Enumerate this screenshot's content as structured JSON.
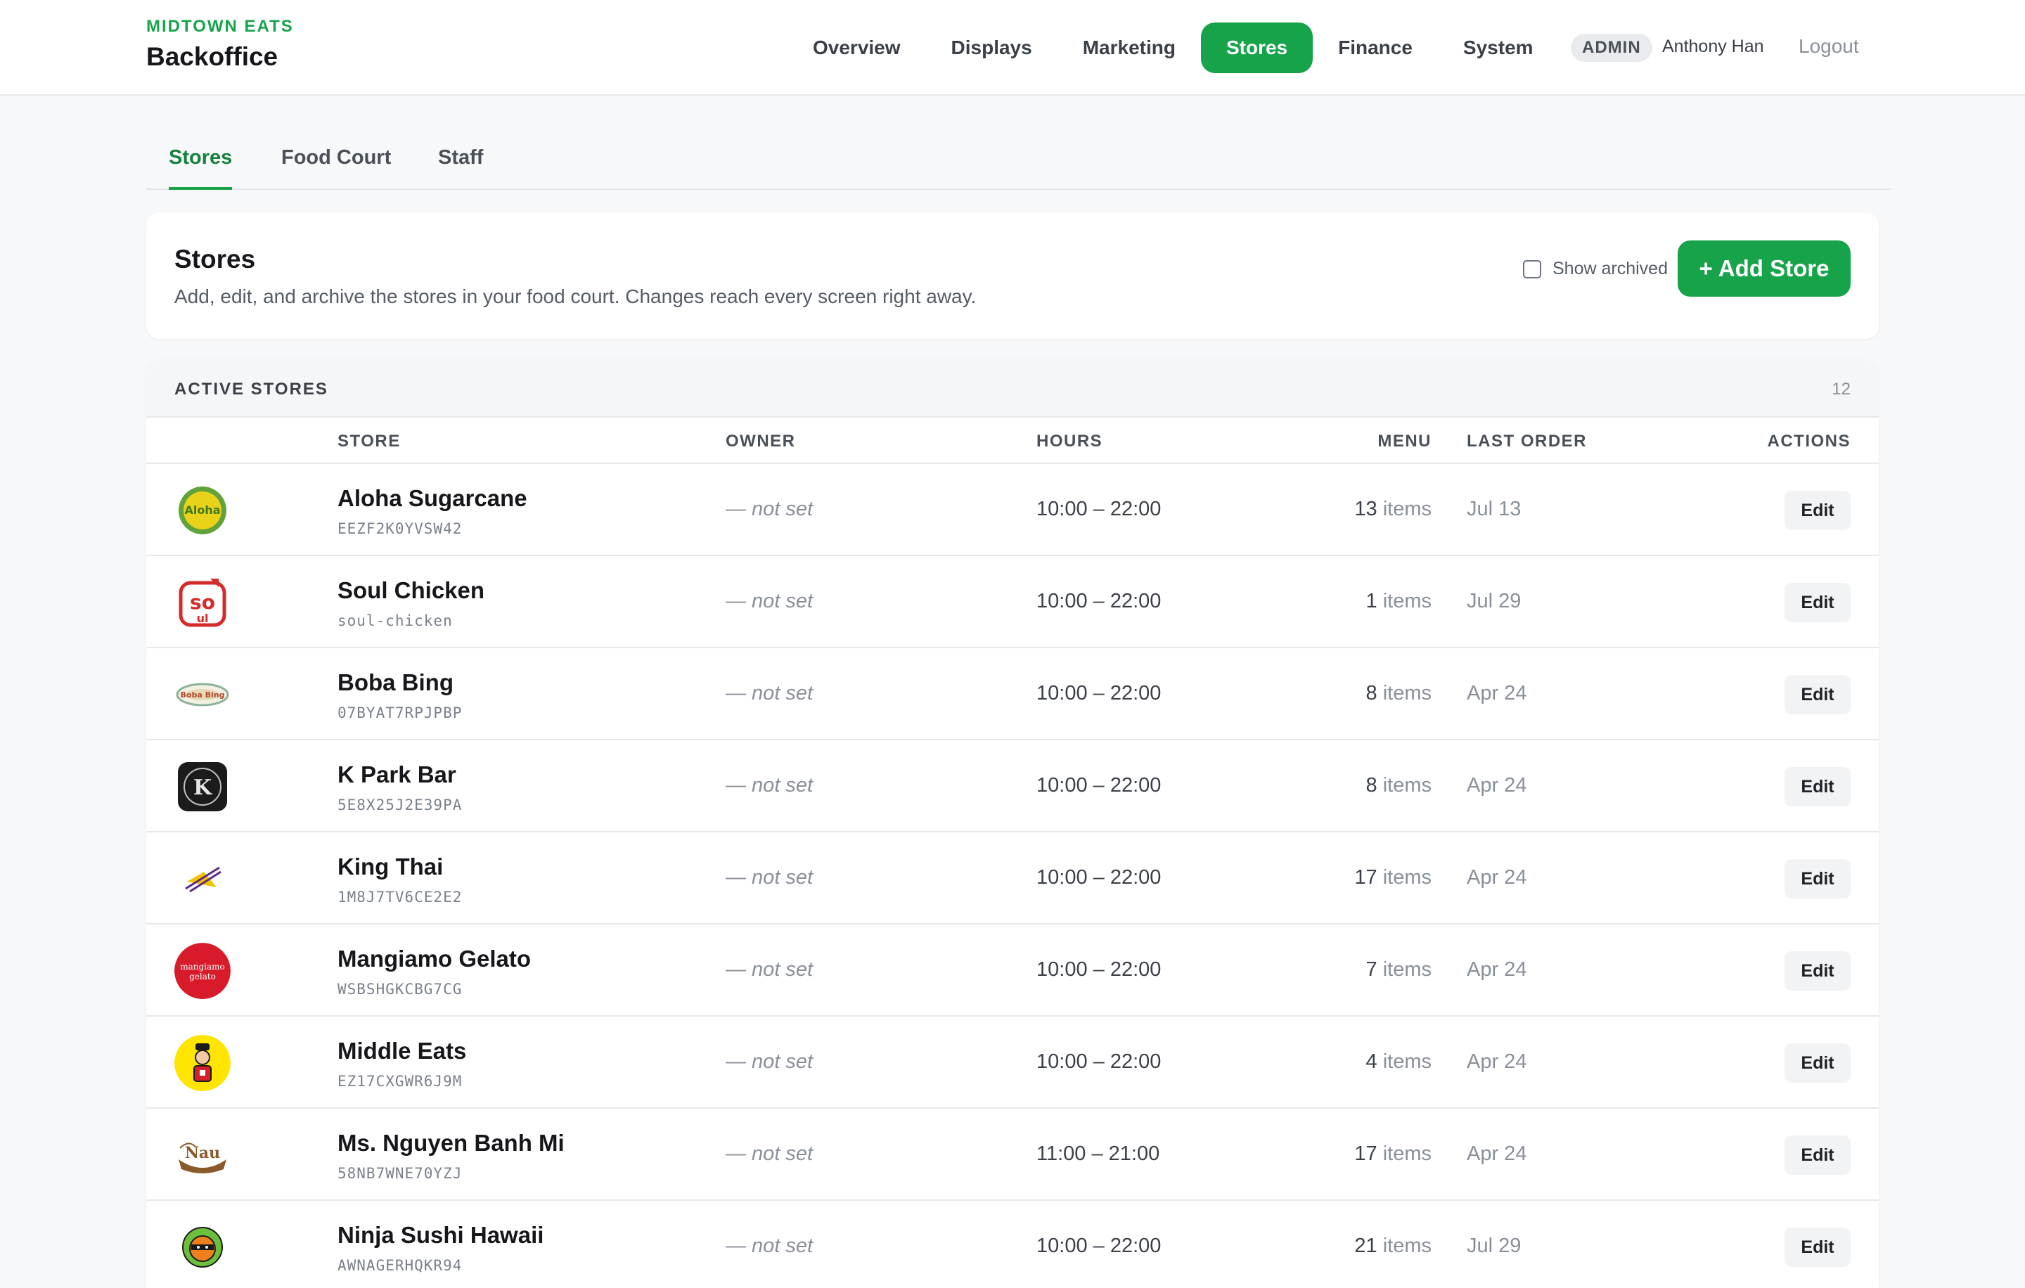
{
  "brand": {
    "org": "MIDTOWN EATS",
    "app": "Backoffice"
  },
  "nav": {
    "items": [
      "Overview",
      "Displays",
      "Marketing",
      "Stores",
      "Finance",
      "System"
    ],
    "active": "Stores"
  },
  "user": {
    "role": "ADMIN",
    "name": "Anthony Han",
    "logout": "Logout"
  },
  "subtabs": {
    "items": [
      "Stores",
      "Food Court",
      "Staff"
    ],
    "active": "Stores"
  },
  "header": {
    "title": "Stores",
    "description": "Add, edit, and archive the stores in your food court. Changes reach every screen right away.",
    "show_archived_label": "Show archived",
    "show_archived_checked": false,
    "add_button": "+ Add Store"
  },
  "table": {
    "section_label": "ACTIVE STORES",
    "count": "12",
    "columns": {
      "store": "STORE",
      "owner": "OWNER",
      "hours": "HOURS",
      "menu": "MENU",
      "last_order": "LAST ORDER",
      "actions": "ACTIONS"
    },
    "edit_label": "Edit",
    "items_suffix": "items",
    "rows": [
      {
        "name": "Aloha Sugarcane",
        "id": "EEZF2K0YVSW42",
        "owner": "— not set",
        "hours": "10:00 – 22:00",
        "menu_count": "13",
        "last_order": "Jul 13",
        "logo_icon": "aloha-logo-icon"
      },
      {
        "name": "Soul Chicken",
        "id": "soul-chicken",
        "owner": "— not set",
        "hours": "10:00 – 22:00",
        "menu_count": "1",
        "last_order": "Jul 29",
        "logo_icon": "soul-logo-icon"
      },
      {
        "name": "Boba Bing",
        "id": "07BYAT7RPJPBP",
        "owner": "— not set",
        "hours": "10:00 – 22:00",
        "menu_count": "8",
        "last_order": "Apr 24",
        "logo_icon": "boba-logo-icon"
      },
      {
        "name": "K Park Bar",
        "id": "5E8X25J2E39PA",
        "owner": "— not set",
        "hours": "10:00 – 22:00",
        "menu_count": "8",
        "last_order": "Apr 24",
        "logo_icon": "kpark-logo-icon"
      },
      {
        "name": "King Thai",
        "id": "1M8J7TV6CE2E2",
        "owner": "— not set",
        "hours": "10:00 – 22:00",
        "menu_count": "17",
        "last_order": "Apr 24",
        "logo_icon": "kingthai-logo-icon"
      },
      {
        "name": "Mangiamo Gelato",
        "id": "WSBSHGKCBG7CG",
        "owner": "— not set",
        "hours": "10:00 – 22:00",
        "menu_count": "7",
        "last_order": "Apr 24",
        "logo_icon": "mangiamo-logo-icon"
      },
      {
        "name": "Middle Eats",
        "id": "EZ17CXGWR6J9M",
        "owner": "— not set",
        "hours": "10:00 – 22:00",
        "menu_count": "4",
        "last_order": "Apr 24",
        "logo_icon": "middle-eats-logo-icon"
      },
      {
        "name": "Ms. Nguyen Banh Mi",
        "id": "58NB7WNE70YZJ",
        "owner": "— not set",
        "hours": "11:00 – 21:00",
        "menu_count": "17",
        "last_order": "Apr 24",
        "logo_icon": "nguyen-logo-icon"
      },
      {
        "name": "Ninja Sushi Hawaii",
        "id": "AWNAGERHQKR94",
        "owner": "— not set",
        "hours": "10:00 – 22:00",
        "menu_count": "21",
        "last_order": "Jul 29",
        "logo_icon": "ninja-logo-icon"
      }
    ]
  },
  "colors": {
    "accent": "#16a34a",
    "accent_dark": "#16803c",
    "muted": "#8a9099"
  }
}
